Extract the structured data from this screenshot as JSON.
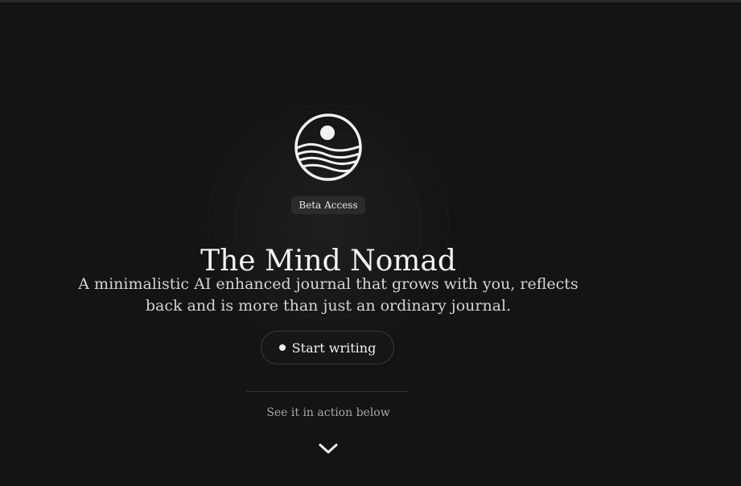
{
  "badge": {
    "label": "Beta Access"
  },
  "hero": {
    "title": "The Mind Nomad",
    "subtitle": "A minimalistic AI enhanced journal that grows with you, reflects back and is more than just an ordinary journal."
  },
  "cta": {
    "label": "Start writing",
    "icon": "dot-icon"
  },
  "scroll_hint": {
    "label": "See it in action below",
    "icon": "chevron-down-icon"
  },
  "logo": {
    "icon": "sun-over-waves-logo"
  },
  "colors": {
    "background": "#141414",
    "text": "#f2f2f2",
    "muted": "#a8a8a8",
    "badge_bg": "#2b2b2b",
    "button_border": "#3a3a3a"
  }
}
